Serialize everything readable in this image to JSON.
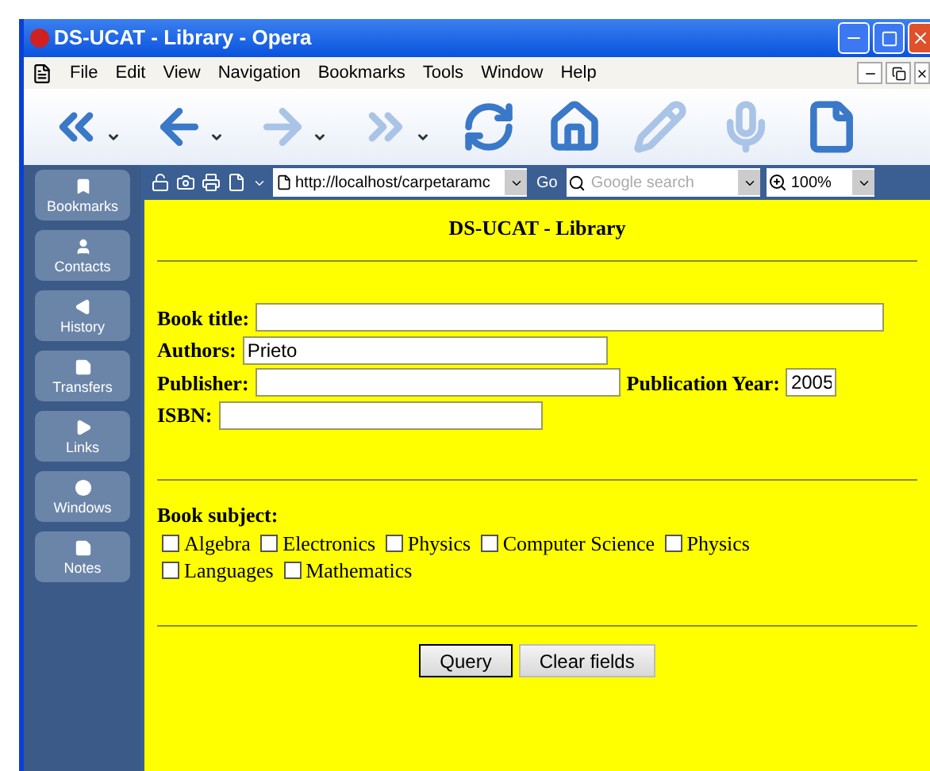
{
  "window": {
    "title": "DS-UCAT - Library - Opera"
  },
  "menu": [
    "File",
    "Edit",
    "View",
    "Navigation",
    "Bookmarks",
    "Tools",
    "Window",
    "Help"
  ],
  "toolbar": [
    {
      "kind": "rewind",
      "disabled": false
    },
    {
      "kind": "back",
      "disabled": false
    },
    {
      "kind": "forward",
      "disabled": true
    },
    {
      "kind": "fastforward",
      "disabled": true
    },
    {
      "kind": "reload",
      "disabled": false
    },
    {
      "kind": "home",
      "disabled": false
    },
    {
      "kind": "edit",
      "disabled": true
    },
    {
      "kind": "voice",
      "disabled": true
    },
    {
      "kind": "page",
      "disabled": false
    }
  ],
  "address_bar": {
    "url": "http://localhost/carpetaramc",
    "go": "Go",
    "search_placeholder": "Google search",
    "zoom": "100%"
  },
  "sidebar": {
    "items": [
      {
        "kind": "bookmarks",
        "label": "Bookmarks"
      },
      {
        "kind": "contacts",
        "label": "Contacts"
      },
      {
        "kind": "history",
        "label": "History"
      },
      {
        "kind": "transfers",
        "label": "Transfers"
      },
      {
        "kind": "links",
        "label": "Links"
      },
      {
        "kind": "windows",
        "label": "Windows"
      },
      {
        "kind": "notes",
        "label": "Notes"
      }
    ]
  },
  "page": {
    "heading": "DS-UCAT - Library",
    "fields": [
      {
        "label": "Book title:"
      },
      {
        "label": "Authors:",
        "value": "Prieto"
      },
      {
        "label": "Publisher:"
      },
      {
        "label": "Publication Year:",
        "value": "2005"
      },
      {
        "label": "ISBN:"
      }
    ],
    "subject_label": "Book subject:",
    "subjects": [
      {
        "label": "Algebra",
        "checked": false
      },
      {
        "label": "Electronics",
        "checked": false
      },
      {
        "label": "Physics",
        "checked": false
      },
      {
        "label": "Computer Science",
        "checked": false
      },
      {
        "label": "Physics",
        "checked": false
      },
      {
        "label": "Languages",
        "checked": false
      },
      {
        "label": "Mathematics",
        "checked": false
      }
    ],
    "buttons": [
      {
        "label": "Query",
        "selected": true
      },
      {
        "label": "Clear fields",
        "selected": false
      }
    ]
  }
}
